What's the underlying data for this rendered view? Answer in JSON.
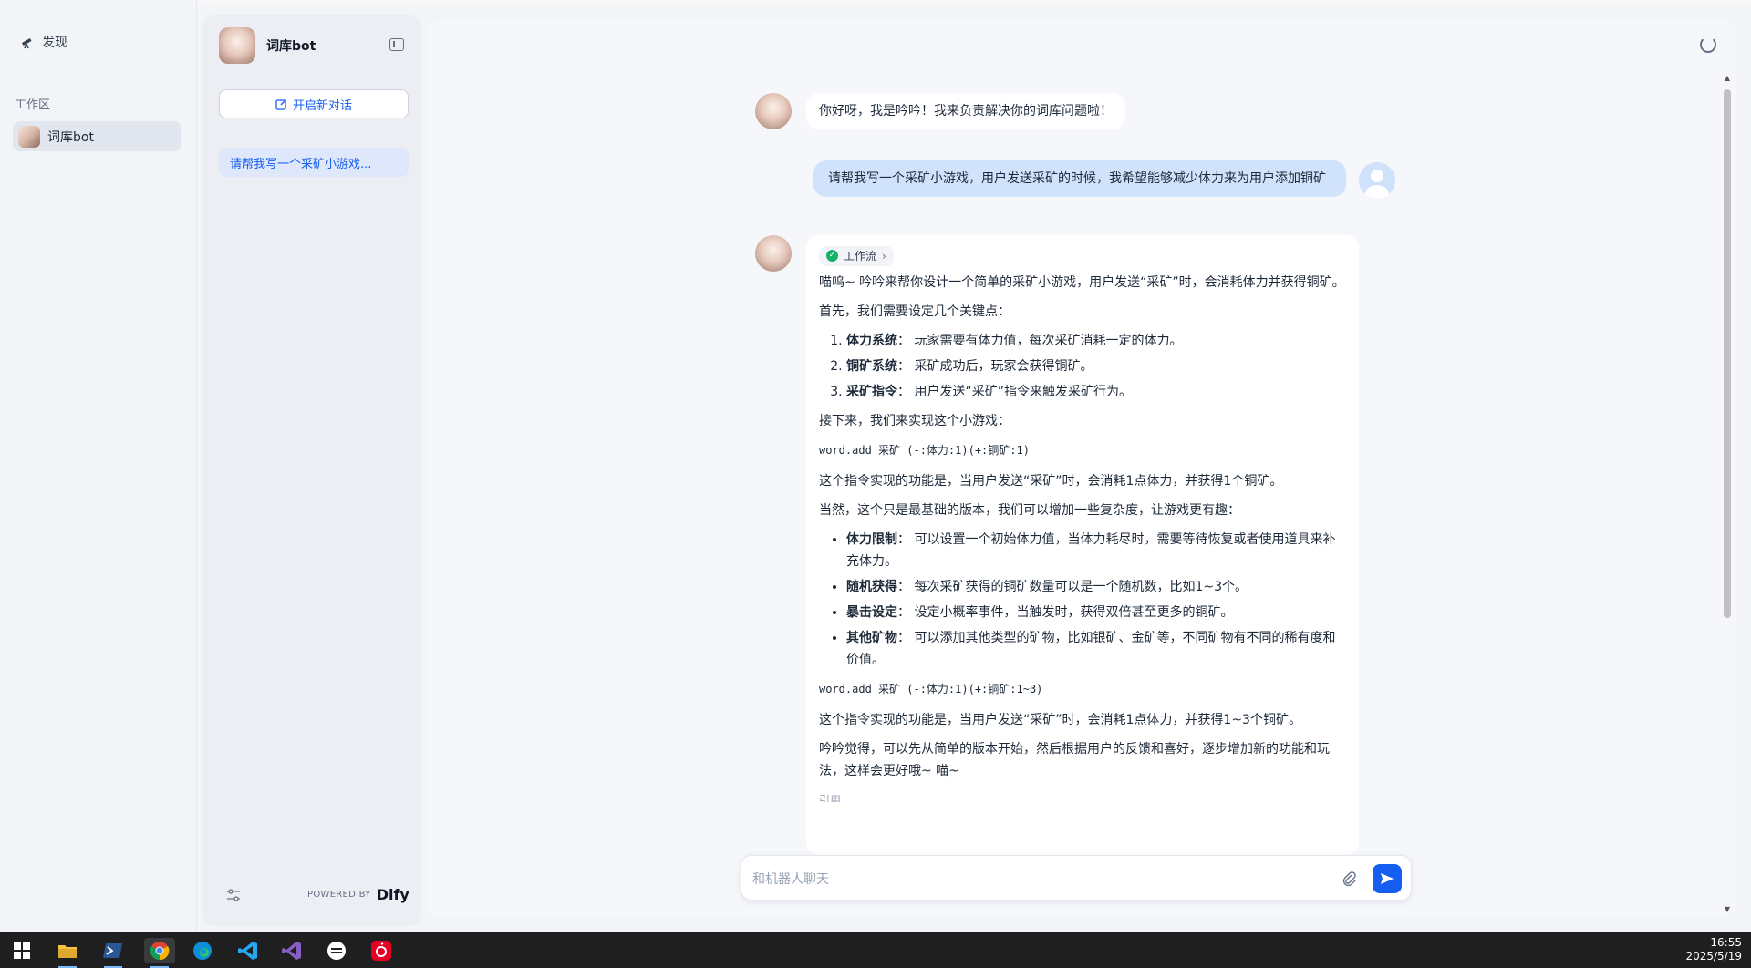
{
  "leftnav": {
    "discover_label": "发现",
    "workspace_label": "工作区",
    "workspace_item": "词库bot"
  },
  "sidebar": {
    "app_name": "词库bot",
    "new_chat_label": "开启新对话",
    "conversation_item": "请帮我写一个采矿小游戏...",
    "powered_by": "POWERED BY",
    "brand": "Dify"
  },
  "chat": {
    "greeting": "你好呀，我是吟吟！我来负责解决你的词库问题啦！",
    "user_message": "请帮我写一个采矿小游戏，用户发送采矿的时候，我希望能够减少体力来为用户添加铜矿",
    "workflow_tag": "工作流",
    "answer": {
      "intro": "喵呜~ 吟吟来帮你设计一个简单的采矿小游戏，用户发送“采矿”时，会消耗体力并获得铜矿。",
      "p1": "首先，我们需要设定几个关键点：",
      "ol": [
        {
          "bold": "体力系统",
          "text": "：  玩家需要有体力值，每次采矿消耗一定的体力。"
        },
        {
          "bold": "铜矿系统",
          "text": "：  采矿成功后，玩家会获得铜矿。"
        },
        {
          "bold": "采矿指令",
          "text": "：  用户发送“采矿”指令来触发采矿行为。"
        }
      ],
      "p2": "接下来，我们来实现这个小游戏：",
      "code1": "word.add 采矿 (-:体力:1)(+:铜矿:1)",
      "p3": "这个指令实现的功能是，当用户发送“采矿”时，会消耗1点体力，并获得1个铜矿。",
      "p4": "当然，这个只是最基础的版本，我们可以增加一些复杂度，让游戏更有趣：",
      "ul": [
        {
          "bold": "体力限制",
          "text": "：  可以设置一个初始体力值，当体力耗尽时，需要等待恢复或者使用道具来补充体力。"
        },
        {
          "bold": "随机获得",
          "text": "：  每次采矿获得的铜矿数量可以是一个随机数，比如1~3个。"
        },
        {
          "bold": "暴击设定",
          "text": "：  设定小概率事件，当触发时，获得双倍甚至更多的铜矿。"
        },
        {
          "bold": "其他矿物",
          "text": "：  可以添加其他类型的矿物，比如银矿、金矿等，不同矿物有不同的稀有度和价值。"
        }
      ],
      "code2": "word.add 采矿 (-:体力:1)(+:铜矿:1~3)",
      "p5": "这个指令实现的功能是，当用户发送“采矿”时，会消耗1点体力，并获得1~3个铜矿。",
      "p6": "吟吟觉得，可以先从简单的版本开始，然后根据用户的反馈和喜好，逐步增加新的功能和玩法，这样会更好哦~ 喵~",
      "cite": "引用"
    },
    "input_placeholder": "和机器人聊天"
  },
  "taskbar": {
    "time": "16:55",
    "date": "2025/5/19",
    "icons": [
      "windows-start",
      "file-explorer",
      "terminal",
      "chrome",
      "edge",
      "vscode",
      "visual-studio",
      "app-circle",
      "netease-music"
    ]
  },
  "colors": {
    "accent": "#155eef",
    "user_bubble": "#d1e3fc",
    "success": "#17b26a"
  }
}
